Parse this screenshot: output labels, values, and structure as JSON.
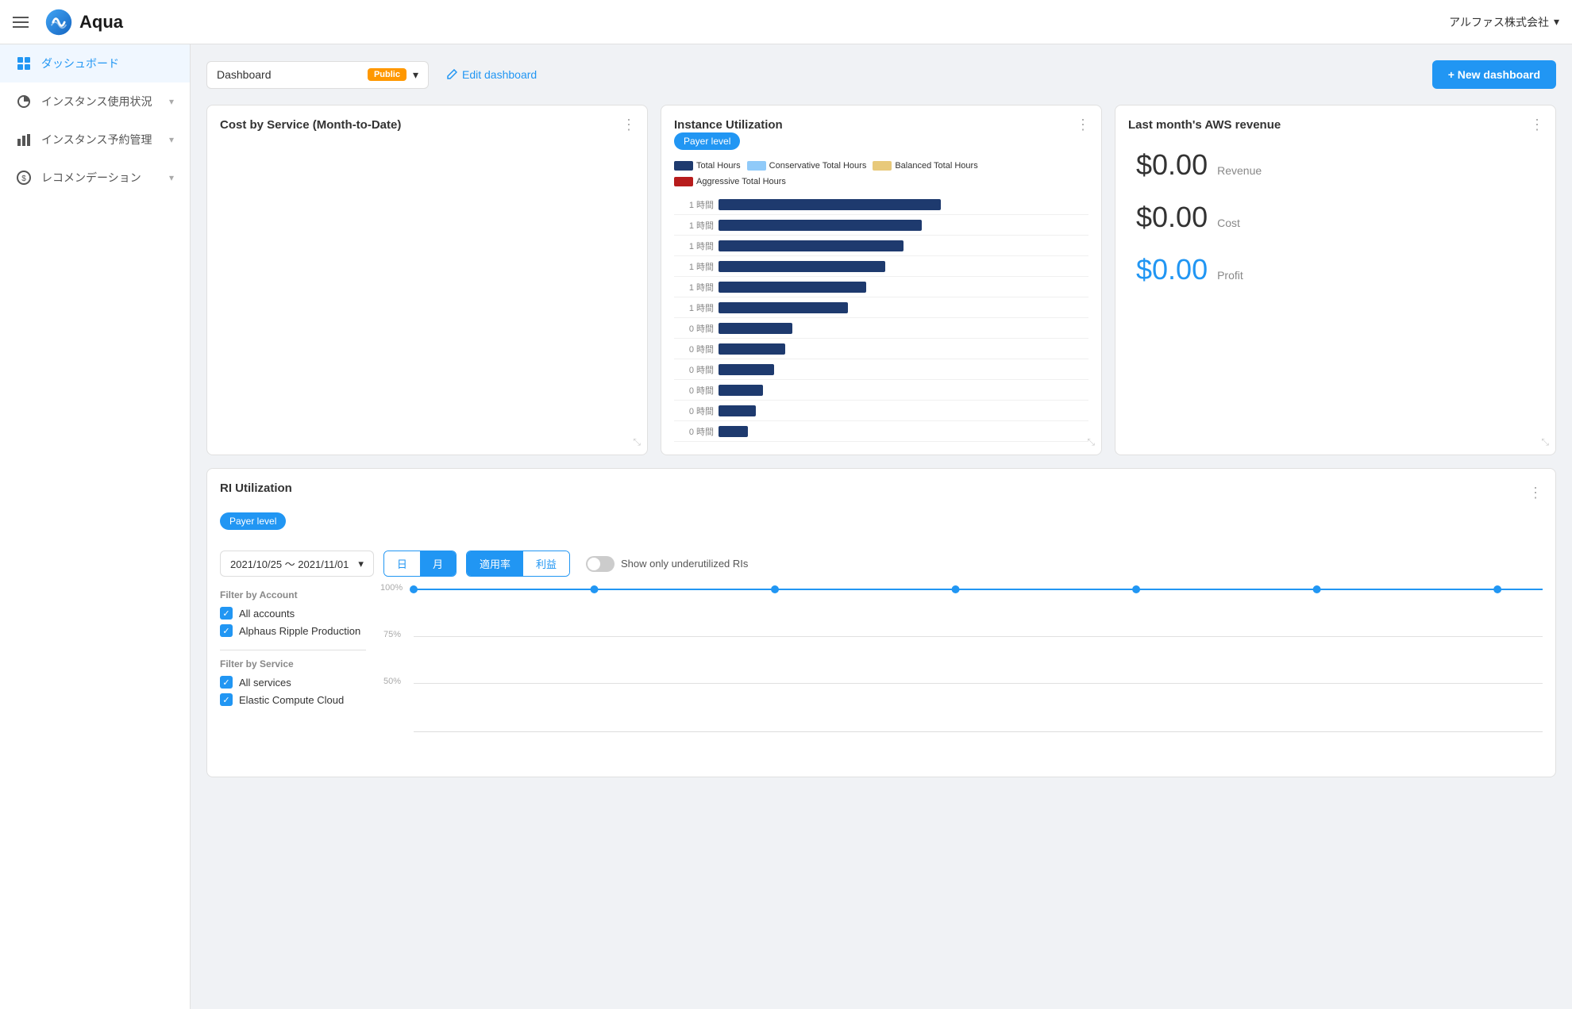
{
  "app": {
    "name": "Aqua",
    "hamburger_label": "menu"
  },
  "company": {
    "name": "アルファス株式会社",
    "chevron": "▾"
  },
  "sidebar": {
    "items": [
      {
        "id": "dashboard",
        "label": "ダッシュボード",
        "icon": "dashboard",
        "active": true,
        "has_chevron": false
      },
      {
        "id": "instance-usage",
        "label": "インスタンス使用状況",
        "icon": "instance",
        "active": false,
        "has_chevron": true
      },
      {
        "id": "instance-reservation",
        "label": "インスタンス予約管理",
        "icon": "bar-chart",
        "active": false,
        "has_chevron": true
      },
      {
        "id": "recommendation",
        "label": "レコメンデーション",
        "icon": "dollar",
        "active": false,
        "has_chevron": true
      }
    ]
  },
  "topbar": {
    "dashboard_label": "Dashboard",
    "public_badge": "Public",
    "edit_label": "Edit dashboard",
    "new_label": "+ New dashboard"
  },
  "cards": {
    "cost_by_service": {
      "title": "Cost by Service (Month-to-Date)"
    },
    "instance_utilization": {
      "title": "Instance Utilization",
      "payer_label": "Payer level",
      "legend": [
        {
          "label": "Total Hours",
          "color": "#1e3a6e"
        },
        {
          "label": "Conservative Total Hours",
          "color": "#90caf9"
        },
        {
          "label": "Balanced Total Hours",
          "color": "#e8c97a"
        },
        {
          "label": "Aggressive Total Hours",
          "color": "#b71c1c"
        }
      ],
      "rows": [
        {
          "label": "1 時間",
          "value": 60
        },
        {
          "label": "1 時間",
          "value": 55
        },
        {
          "label": "1 時間",
          "value": 50
        },
        {
          "label": "1 時間",
          "value": 45
        },
        {
          "label": "1 時間",
          "value": 40
        },
        {
          "label": "1 時間",
          "value": 35
        },
        {
          "label": "0 時間",
          "value": 20
        },
        {
          "label": "0 時間",
          "value": 18
        },
        {
          "label": "0 時間",
          "value": 15
        },
        {
          "label": "0 時間",
          "value": 12
        },
        {
          "label": "0 時間",
          "value": 10
        },
        {
          "label": "0 時間",
          "value": 8
        }
      ]
    },
    "aws_revenue": {
      "title": "Last month's AWS revenue",
      "revenue_value": "$0.00",
      "revenue_label": "Revenue",
      "cost_value": "$0.00",
      "cost_label": "Cost",
      "profit_value": "$0.00",
      "profit_label": "Profit"
    }
  },
  "ri_utilization": {
    "title": "RI Utilization",
    "payer_label": "Payer level",
    "date_range": "2021/10/25 〜 2021/11/01",
    "tabs": [
      {
        "label": "日",
        "active": false
      },
      {
        "label": "月",
        "active": true
      }
    ],
    "filters": [
      {
        "label": "適用率",
        "active": true
      },
      {
        "label": "利益",
        "active": false
      }
    ],
    "toggle_label": "Show only underutilized RIs",
    "filter_account_title": "Filter by Account",
    "accounts": [
      {
        "label": "All accounts",
        "checked": true
      },
      {
        "label": "Alphaus Ripple Production",
        "checked": true
      }
    ],
    "filter_service_title": "Filter by Service",
    "services": [
      {
        "label": "All services",
        "checked": true
      },
      {
        "label": "Elastic Compute Cloud",
        "checked": true
      }
    ],
    "chart_labels": [
      "100%",
      "75%",
      "50%"
    ]
  }
}
